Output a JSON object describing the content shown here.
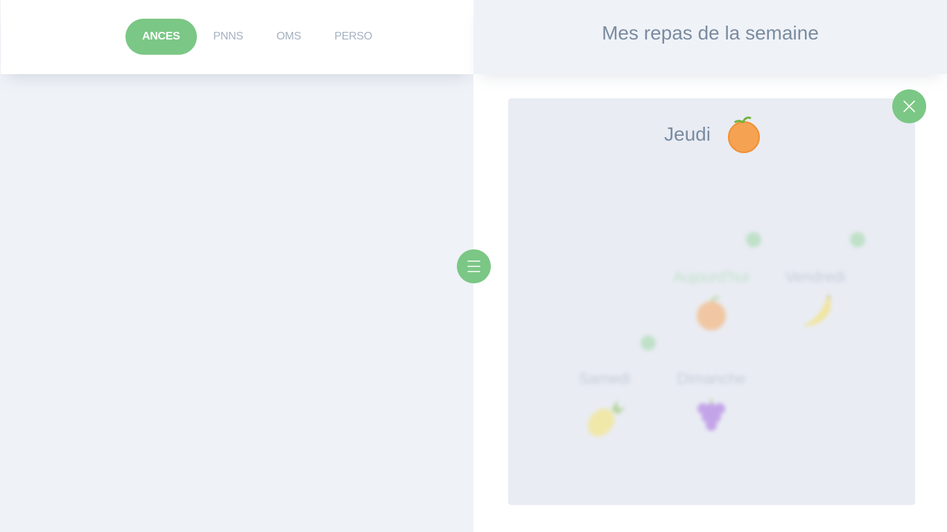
{
  "nav": {
    "tabs": [
      {
        "label": "ANCES",
        "active": true
      },
      {
        "label": "PNNS",
        "active": false
      },
      {
        "label": "OMS",
        "active": false
      },
      {
        "label": "PERSO",
        "active": false
      }
    ]
  },
  "right": {
    "title": "Mes repas de la semaine",
    "card": {
      "day": "Jeudi",
      "day_icon": "orange-icon",
      "background_items": [
        {
          "label": "Aujourd'hui",
          "icon": "orange-icon"
        },
        {
          "label": "Vendredi",
          "icon": "banana-icon"
        },
        {
          "label": "Samedi",
          "icon": "pineapple-icon"
        },
        {
          "label": "Dimanche",
          "icon": "grapes-icon"
        }
      ]
    },
    "close_icon": "close-icon",
    "menu_icon": "hamburger-menu-icon"
  },
  "colors": {
    "accent": "#7bc785",
    "text_muted": "#7a8ba0",
    "tab_inactive": "#a5b1c2",
    "panel_bg": "#eff2f7"
  }
}
